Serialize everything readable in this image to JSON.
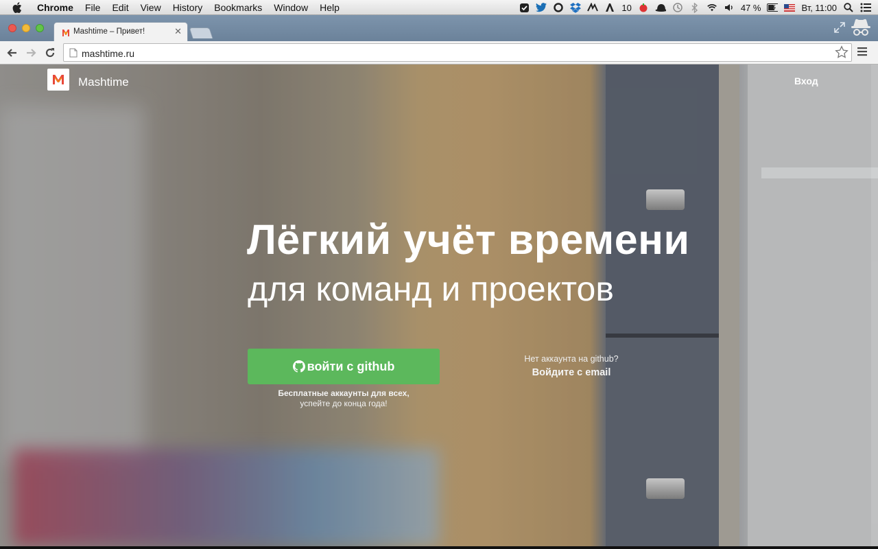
{
  "menubar": {
    "app_name": "Chrome",
    "items": [
      "File",
      "Edit",
      "View",
      "History",
      "Bookmarks",
      "Window",
      "Help"
    ],
    "status": {
      "badge_count": "10",
      "battery": "47 %",
      "clock": "Вт, 11:00"
    }
  },
  "browser": {
    "tab_title": "Mashtime – Привет!",
    "url": "mashtime.ru"
  },
  "page": {
    "brand": "Mashtime",
    "login_label": "Вход",
    "hero_title": "Лёгкий учёт времени",
    "hero_subtitle": "для команд и проектов",
    "github_button": "войти с github",
    "free_note_line1": "Бесплатные аккаунты для всех,",
    "free_note_line2": "успейте до конца года!",
    "no_account": "Нет аккаунта на github?",
    "email_login": "Войдите с email"
  },
  "colors": {
    "accent_green": "#5cb85c",
    "brand_orange": "#f39c12"
  }
}
